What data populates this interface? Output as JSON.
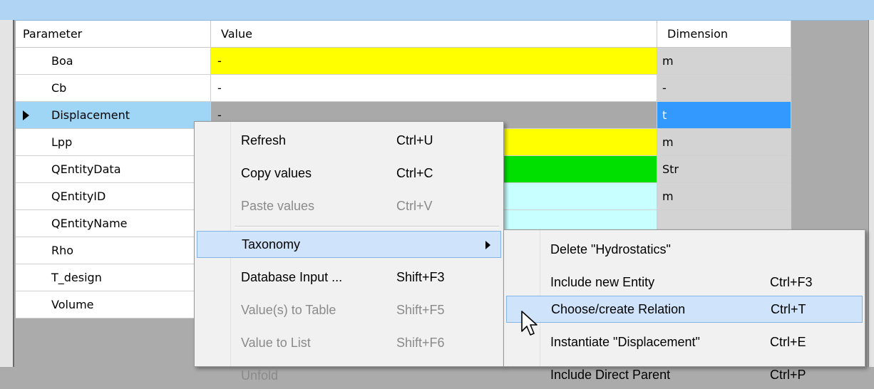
{
  "grid": {
    "headers": {
      "param": "Parameter",
      "value": "Value",
      "dim": "Dimension"
    },
    "rows": [
      {
        "param": "Boa",
        "value": "-",
        "dim": "m",
        "value_bg": "#ffff00",
        "dim_bg": "#d3d3d3"
      },
      {
        "param": "Cb",
        "value": "-",
        "dim": "-",
        "value_bg": "#ffffff",
        "dim_bg": "#d3d3d3"
      },
      {
        "param": "Displacement",
        "value": "-",
        "dim": "t",
        "value_bg": "#a9a9a9",
        "dim_bg": "#3399ff",
        "selected": true
      },
      {
        "param": "Lpp",
        "value": "",
        "dim": "m",
        "value_bg": "#ffff00",
        "dim_bg": "#d3d3d3"
      },
      {
        "param": "QEntityData",
        "value": "",
        "dim": "Str",
        "value_bg": "#00e000",
        "dim_bg": "#d3d3d3"
      },
      {
        "param": "QEntityID",
        "value": "",
        "dim": "m",
        "value_bg": "#c8ffff",
        "dim_bg": "#d3d3d3"
      },
      {
        "param": "QEntityName",
        "value": "",
        "dim": "",
        "value_bg": "#c8ffff",
        "dim_bg": "#d3d3d3"
      },
      {
        "param": "Rho",
        "value": "",
        "dim": "",
        "value_bg": "#ffffff",
        "dim_bg": "#d3d3d3"
      },
      {
        "param": "T_design",
        "value": "",
        "dim": "",
        "value_bg": "#ffffff",
        "dim_bg": "#d3d3d3"
      },
      {
        "param": "Volume",
        "value": "",
        "dim": "",
        "value_bg": "#ffffff",
        "dim_bg": "#d3d3d3"
      }
    ]
  },
  "context_menu": {
    "items": [
      {
        "label": "Refresh",
        "shortcut": "Ctrl+U",
        "enabled": true
      },
      {
        "label": "Copy values",
        "shortcut": "Ctrl+C",
        "enabled": true
      },
      {
        "label": "Paste values",
        "shortcut": "Ctrl+V",
        "enabled": false
      },
      {
        "label": "Taxonomy",
        "shortcut": "",
        "enabled": true,
        "submenu": true,
        "highlighted": true
      },
      {
        "label": "Database Input ...",
        "shortcut": "Shift+F3",
        "enabled": true
      },
      {
        "label": "Value(s) to Table",
        "shortcut": "Shift+F5",
        "enabled": false
      },
      {
        "label": "Value to List",
        "shortcut": "Shift+F6",
        "enabled": false
      },
      {
        "label": "Unfold",
        "shortcut": "",
        "enabled": false
      }
    ]
  },
  "submenu": {
    "items": [
      {
        "label": "Delete \"Hydrostatics\"",
        "shortcut": ""
      },
      {
        "label": "Include new Entity",
        "shortcut": "Ctrl+F3"
      },
      {
        "label": "Choose/create Relation",
        "shortcut": "Ctrl+T",
        "highlighted": true
      },
      {
        "label": "Instantiate \"Displacement\"",
        "shortcut": "Ctrl+E"
      },
      {
        "label": "Include Direct Parent",
        "shortcut": "Ctrl+P"
      }
    ]
  },
  "colors": {
    "selection_blue": "#3399ff",
    "row_select": "#9fd6f5",
    "menu_highlight": "#cfe4fb"
  }
}
